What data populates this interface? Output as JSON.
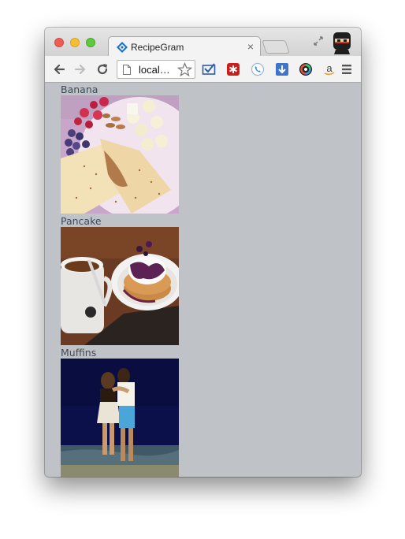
{
  "browser": {
    "tab_title": "RecipeGram",
    "tab_close": "×",
    "url": "local…"
  },
  "recipes": [
    {
      "name": "Banana"
    },
    {
      "name": "Pancake"
    },
    {
      "name": "Muffins"
    }
  ]
}
